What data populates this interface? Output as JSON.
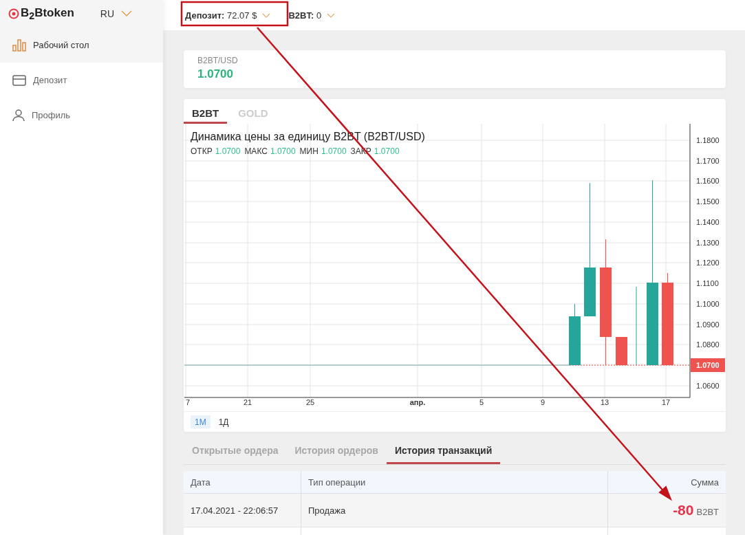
{
  "brand": {
    "logo_text": "B$_{2}$Btoken"
  },
  "language": {
    "value": "RU"
  },
  "sidebar": {
    "items": [
      {
        "label": "Рабочий стол",
        "selected": true
      },
      {
        "label": "Депозит",
        "selected": false
      },
      {
        "label": "Профиль",
        "selected": false
      }
    ]
  },
  "top_bar": {
    "balances": [
      {
        "label": "Депозит:",
        "value": "72.07 $"
      },
      {
        "label": "B2BT:",
        "value": "0"
      }
    ]
  },
  "rate": {
    "pair": "B2BT/USD",
    "value": "1.0700"
  },
  "chart_tabs": [
    {
      "label": "B2BT",
      "selected": true
    },
    {
      "label": "GOLD",
      "selected": false
    }
  ],
  "chart": {
    "title": "Динамика цены за единицу B2BT (B2BT/USD)",
    "ohlc": [
      {
        "label": "ОТКР",
        "value": "1.0700"
      },
      {
        "label": "МАКС",
        "value": "1.0700"
      },
      {
        "label": "МИН",
        "value": "1.0700"
      },
      {
        "label": "ЗАКР",
        "value": "1.0700"
      }
    ],
    "y_ticks": [
      "1.1800",
      "1.1700",
      "1.1600",
      "1.1500",
      "1.1400",
      "1.1300",
      "1.1200",
      "1.1100",
      "1.1000",
      "1.0900",
      "1.0800",
      "1.0600"
    ],
    "x_ticks": [
      "7",
      "21",
      "25",
      "апр.",
      "5",
      "9",
      "13",
      "17"
    ],
    "last_price": "1.0700"
  },
  "ranges": [
    {
      "label": "1М",
      "selected": true
    },
    {
      "label": "1Д",
      "selected": false
    }
  ],
  "history_tabs": [
    {
      "label": "Открытые ордера",
      "selected": false
    },
    {
      "label": "История ордеров",
      "selected": false
    },
    {
      "label": "История транзакций",
      "selected": true
    }
  ],
  "table": {
    "columns": [
      "Дата",
      "Тип операции",
      "Сумма"
    ],
    "rows": [
      {
        "date": "17.04.2021 - 22:06:57",
        "type": "Продажа",
        "amount": "-80",
        "unit": "B2BT"
      }
    ]
  }
}
